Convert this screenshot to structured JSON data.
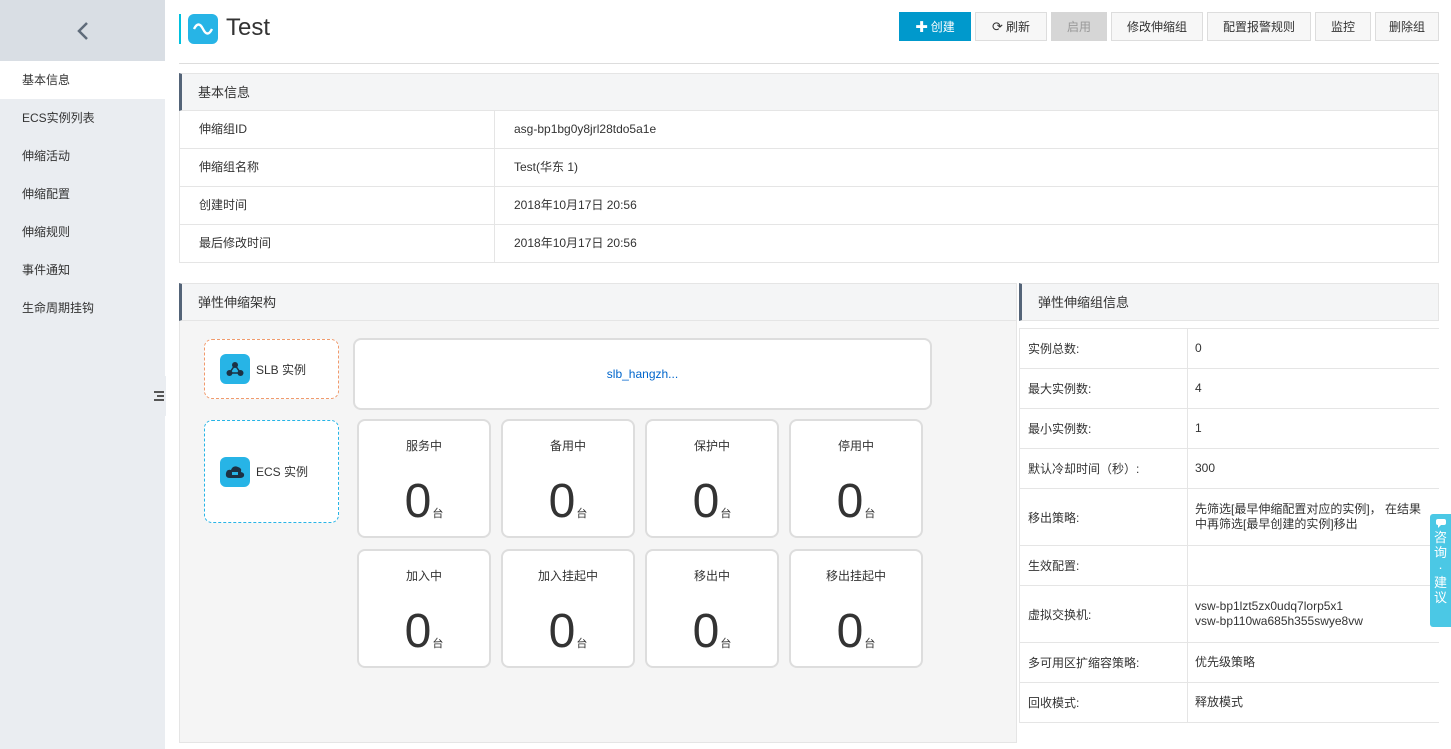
{
  "sidebar": {
    "items": [
      {
        "label": "基本信息"
      },
      {
        "label": "ECS实例列表"
      },
      {
        "label": "伸缩活动"
      },
      {
        "label": "伸缩配置"
      },
      {
        "label": "伸缩规则"
      },
      {
        "label": "事件通知"
      },
      {
        "label": "生命周期挂钩"
      }
    ],
    "active_index": 0
  },
  "header": {
    "title": "Test",
    "logo_icon": "scaling-group-icon",
    "accent": "#27b4e6"
  },
  "toolbar": {
    "create": "创建",
    "refresh": "刷新",
    "enable": "启用",
    "modify": "修改伸缩组",
    "alarm": "配置报警规则",
    "monitor": "监控",
    "delete": "删除组"
  },
  "basic": {
    "title": "基本信息",
    "rows": [
      {
        "k": "伸缩组ID",
        "v": "asg-bp1bg0y8jrl28tdo5a1e"
      },
      {
        "k": "伸缩组名称",
        "v": "Test(华东 1)"
      },
      {
        "k": "创建时间",
        "v": "2018年10月17日 20:56"
      },
      {
        "k": "最后修改时间",
        "v": "2018年10月17日 20:56"
      }
    ]
  },
  "arch": {
    "title": "弹性伸缩架构",
    "slb_label": "SLB 实例",
    "ecs_label": "ECS 实例",
    "slb_name": "slb_hangzh...",
    "unit": "台",
    "states": [
      {
        "label": "服务中",
        "count": "0"
      },
      {
        "label": "备用中",
        "count": "0"
      },
      {
        "label": "保护中",
        "count": "0"
      },
      {
        "label": "停用中",
        "count": "0"
      },
      {
        "label": "加入中",
        "count": "0"
      },
      {
        "label": "加入挂起中",
        "count": "0"
      },
      {
        "label": "移出中",
        "count": "0"
      },
      {
        "label": "移出挂起中",
        "count": "0"
      }
    ]
  },
  "info": {
    "title": "弹性伸缩组信息",
    "rows": [
      {
        "k": "实例总数:",
        "v": [
          "0"
        ]
      },
      {
        "k": "最大实例数:",
        "v": [
          "4"
        ]
      },
      {
        "k": "最小实例数:",
        "v": [
          "1"
        ]
      },
      {
        "k": "默认冷却时间（秒）:",
        "v": [
          "300"
        ]
      },
      {
        "k": "移出策略:",
        "v": [
          "先筛选[最早伸缩配置对应的实例]， 在结果",
          "中再筛选[最早创建的实例]移出"
        ]
      },
      {
        "k": "生效配置:",
        "v": [
          ""
        ]
      },
      {
        "k": "虚拟交换机:",
        "v": [
          "vsw-bp1lzt5zx0udq7lorp5x1",
          "vsw-bp110wa685h355swye8vw"
        ]
      },
      {
        "k": "多可用区扩缩容策略:",
        "v": [
          "优先级策略"
        ]
      },
      {
        "k": "回收模式:",
        "v": [
          "释放模式"
        ]
      }
    ]
  },
  "side_tab": {
    "label": [
      "咨",
      "询",
      "·",
      "建",
      "议"
    ]
  }
}
